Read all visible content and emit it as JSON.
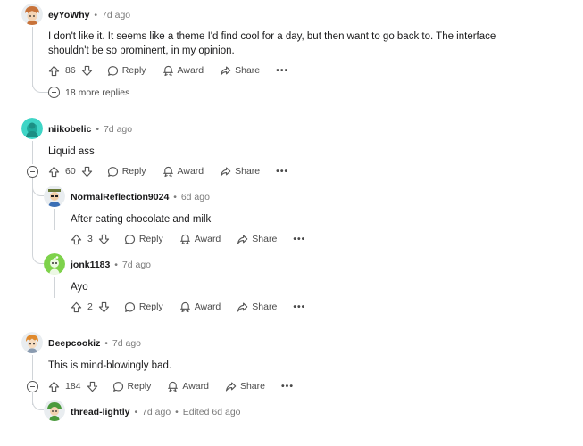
{
  "comments": [
    {
      "user": "eyYoWhy",
      "time": "7d ago",
      "text": "I don't like it. It seems like a theme I'd find cool for a day, but then want to go back to. The interface shouldn't be so prominent, in my opinion.",
      "votes": "86",
      "more_replies": "18 more replies"
    },
    {
      "user": "niikobelic",
      "time": "7d ago",
      "text": "Liquid ass",
      "votes": "60",
      "replies": [
        {
          "user": "NormalReflection9024",
          "time": "6d ago",
          "text": "After eating chocolate and milk",
          "votes": "3"
        },
        {
          "user": "jonk1183",
          "time": "7d ago",
          "text": "Ayo",
          "votes": "2"
        }
      ]
    },
    {
      "user": "Deepcookiz",
      "time": "7d ago",
      "text": "This is mind-blowingly bad.",
      "votes": "184",
      "replies": [
        {
          "user": "thread-lightly",
          "time": "7d ago",
          "edited": "Edited 6d ago"
        }
      ]
    }
  ],
  "actions": {
    "reply": "Reply",
    "award": "Award",
    "share": "Share",
    "more": "•••"
  },
  "separator": "•"
}
